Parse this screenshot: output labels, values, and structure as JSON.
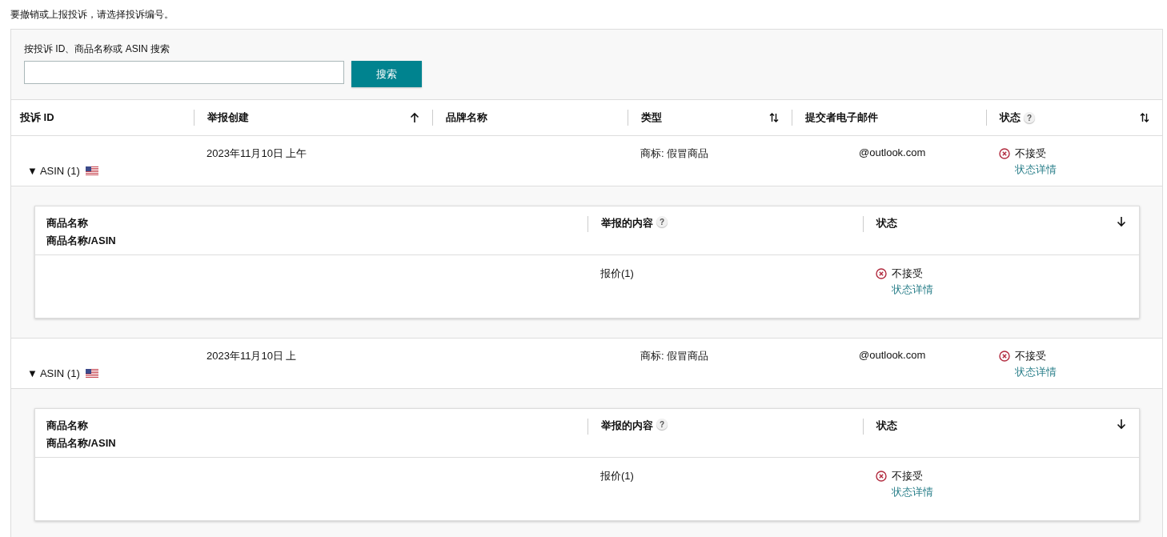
{
  "intro": "要撤销或上报投诉，请选择投诉编号。",
  "search": {
    "label": "按投诉 ID、商品名称或 ASIN 搜索",
    "button": "搜索"
  },
  "table": {
    "columns": [
      {
        "label": "投诉 ID",
        "kind": "plain"
      },
      {
        "label": "举报创建",
        "kind": "ascending"
      },
      {
        "label": "品牌名称",
        "kind": "plain"
      },
      {
        "label": "类型",
        "kind": "sortable"
      },
      {
        "label": "提交者电子邮件",
        "kind": "plain"
      },
      {
        "label": "状态",
        "help": "?",
        "kind": "sortable"
      }
    ],
    "rows": [
      {
        "toggle_icon": "▼",
        "asin_label": "ASIN (1)",
        "created": "2023年11月10日 上午",
        "type": "商标: 假冒商品",
        "email": "@outlook.com",
        "status": {
          "kind": "rejected",
          "label": "不接受",
          "link": "状态详情"
        },
        "expanded": true,
        "detail": {
          "columns": [
            {
              "label": "商品名称",
              "sublabel": "商品名称/ASIN",
              "kind": "plain"
            },
            {
              "label": "举报的内容",
              "help": "?",
              "kind": "plain"
            },
            {
              "label": "状态",
              "kind": "descending"
            }
          ],
          "rows": [
            {
              "content": "报价(1)",
              "status": {
                "kind": "rejected",
                "label": "不接受",
                "link": "状态详情"
              }
            }
          ]
        }
      },
      {
        "toggle_icon": "▼",
        "asin_label": "ASIN (1)",
        "created": "2023年11月10日 上",
        "type": "商标: 假冒商品",
        "email": "@outlook.com",
        "status": {
          "kind": "rejected",
          "label": "不接受",
          "link": "状态详情"
        },
        "expanded": true,
        "detail": {
          "columns": [
            {
              "label": "商品名称",
              "sublabel": "商品名称/ASIN",
              "kind": "plain"
            },
            {
              "label": "举报的内容",
              "help": "?",
              "kind": "plain"
            },
            {
              "label": "状态",
              "kind": "descending"
            }
          ],
          "rows": [
            {
              "content": "报价(1)",
              "status": {
                "kind": "rejected",
                "label": "不接受",
                "link": "状态详情"
              }
            }
          ]
        }
      }
    ]
  }
}
